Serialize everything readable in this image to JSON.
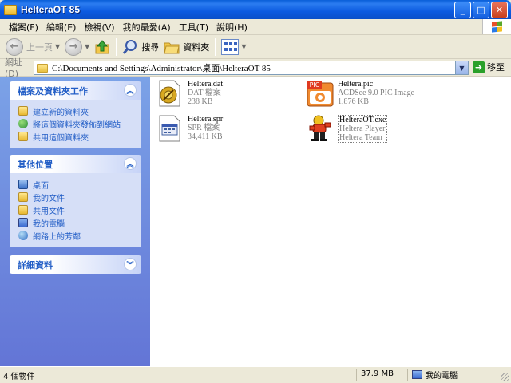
{
  "window": {
    "title": "HelteraOT 85",
    "buttons": {
      "minimize": "_",
      "maximize": "□",
      "close": "✕"
    }
  },
  "menubar": {
    "items": [
      "檔案(F)",
      "編輯(E)",
      "檢視(V)",
      "我的最愛(A)",
      "工具(T)",
      "說明(H)"
    ]
  },
  "toolbar": {
    "back_label": "上一頁",
    "search_label": "搜尋",
    "folders_label": "資料夾"
  },
  "addressbar": {
    "label": "網址(D)",
    "path": "C:\\Documents and Settings\\Administrator\\桌面\\HelteraOT 85",
    "go_label": "移至"
  },
  "left_pane": {
    "file_tasks": {
      "title": "檔案及資料夾工作",
      "items": [
        "建立新的資料夾",
        "將這個資料夾發佈到網站",
        "共用這個資料夾"
      ]
    },
    "other_places": {
      "title": "其他位置",
      "items": [
        "桌面",
        "我的文件",
        "共用文件",
        "我的電腦",
        "網路上的芳鄰"
      ]
    },
    "details": {
      "title": "詳細資料"
    }
  },
  "files": [
    {
      "name": "Heltera.dat",
      "line2": "DAT 檔案",
      "line3": "238 KB",
      "icon": "dat-file-icon"
    },
    {
      "name": "Heltera.pic",
      "line2": "ACDSee 9.0 PIC Image",
      "line3": "1,876 KB",
      "icon": "acdsee-pic-icon",
      "icon_text": "PIC"
    },
    {
      "name": "Heltera.spr",
      "line2": "SPR 檔案",
      "line3": "34,411 KB",
      "icon": "spr-file-icon"
    },
    {
      "name": "HelteraOT.exe",
      "line2": "Heltera Player",
      "line3": "Heltera Team",
      "icon": "heltera-exe-icon"
    }
  ],
  "statusbar": {
    "objects": "4 個物件",
    "size": "37.9 MB",
    "location": "我的電腦"
  },
  "colors": {
    "titlebar": "#0a5fd8",
    "left_pane_top": "#7ba2e7",
    "left_pane_bottom": "#6375d6",
    "task_link": "#215dc6",
    "file_meta": "#808080"
  }
}
